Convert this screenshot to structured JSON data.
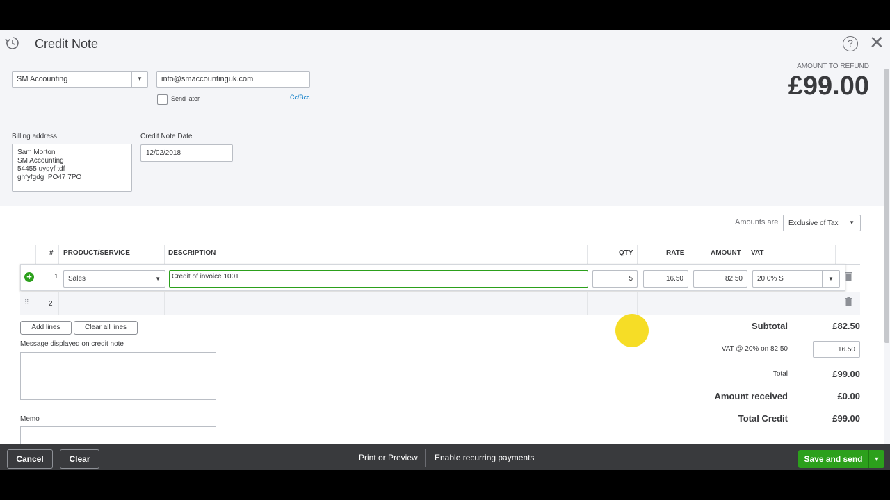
{
  "header": {
    "title": "Credit Note"
  },
  "customer": {
    "value": "SM Accounting"
  },
  "email": {
    "value": "info@smaccountinguk.com"
  },
  "send_later_label": "Send later",
  "cc_bcc_label": "Cc/Bcc",
  "refund": {
    "label": "AMOUNT TO REFUND",
    "value": "£99.00"
  },
  "billing": {
    "label": "Billing address",
    "value": "Sam Morton\nSM Accounting\n54455 uygyf tdf\nghfyfgdg  PO47 7PO"
  },
  "date": {
    "label": "Credit Note Date",
    "value": "12/02/2018"
  },
  "amounts": {
    "label": "Amounts are",
    "value": "Exclusive of Tax"
  },
  "table": {
    "headers": {
      "num": "#",
      "product": "PRODUCT/SERVICE",
      "description": "DESCRIPTION",
      "qty": "QTY",
      "rate": "RATE",
      "amount": "AMOUNT",
      "vat": "VAT"
    },
    "rows": [
      {
        "num": "1",
        "product": "Sales",
        "description": "Credit of invoice 1001",
        "qty": "5",
        "rate": "16.50",
        "amount": "82.50",
        "vat": "20.0% S"
      },
      {
        "num": "2",
        "product": "",
        "description": "",
        "qty": "",
        "rate": "",
        "amount": "",
        "vat": ""
      }
    ]
  },
  "buttons": {
    "add_lines": "Add lines",
    "clear_all_lines": "Clear all lines"
  },
  "message_label": "Message displayed on credit note",
  "memo_label": "Memo",
  "summary": {
    "subtotal_label": "Subtotal",
    "subtotal_value": "£82.50",
    "vat_label": "VAT @ 20% on 82.50",
    "vat_value": "16.50",
    "total_label": "Total",
    "total_value": "£99.00",
    "received_label": "Amount received",
    "received_value": "£0.00",
    "total_credit_label": "Total Credit",
    "total_credit_value": "£99.00"
  },
  "footer": {
    "cancel": "Cancel",
    "clear": "Clear",
    "print_preview": "Print or Preview",
    "recurring": "Enable recurring payments",
    "save_send": "Save and send"
  },
  "colors": {
    "accent": "#2ca01c",
    "link": "#0077c5",
    "footer_bg": "#393a3d"
  }
}
